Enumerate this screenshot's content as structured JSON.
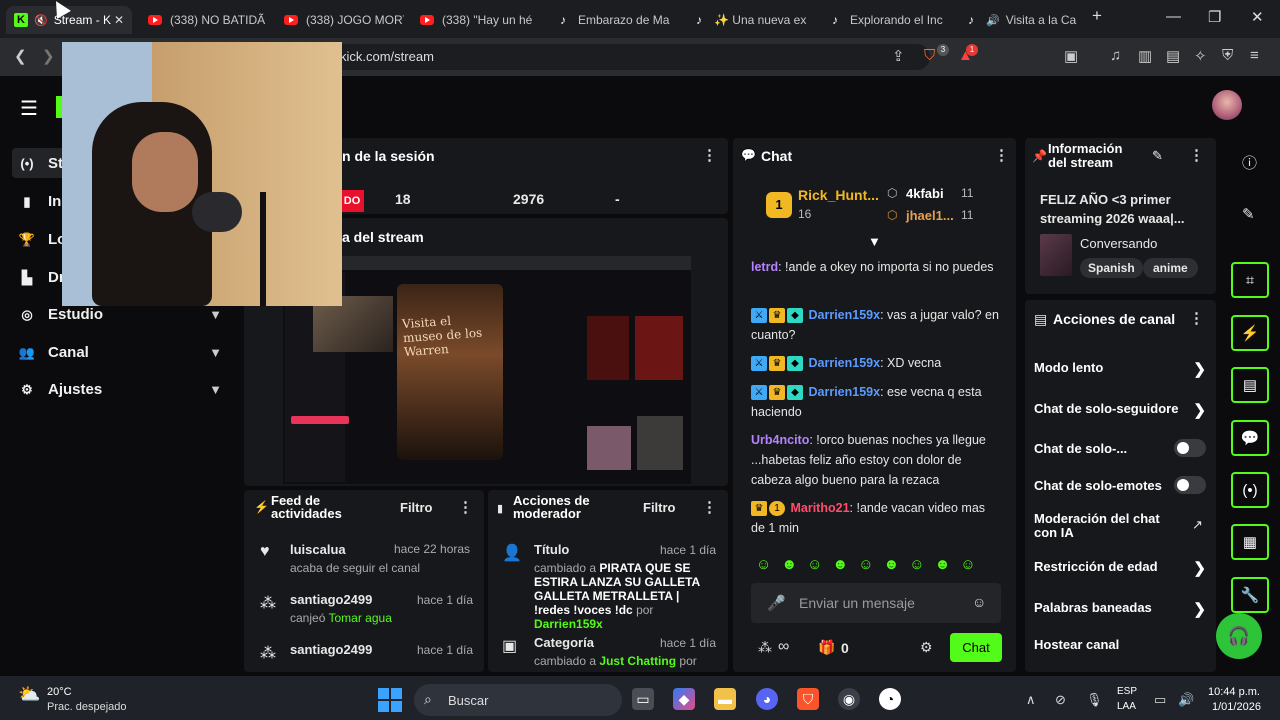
{
  "browser": {
    "tabs": [
      {
        "label": "Stream - K",
        "favicon": "kick"
      },
      {
        "label": "(338) NO BATIDÃ",
        "favicon": "youtube"
      },
      {
        "label": "(338) JOGO MORT",
        "favicon": "youtube"
      },
      {
        "label": "(338) \"Hay un hé",
        "favicon": "youtube"
      },
      {
        "label": "Embarazo de Ma",
        "favicon": "tiktok"
      },
      {
        "label": "✨ Una nueva ex",
        "favicon": "tiktok"
      },
      {
        "label": "Explorando el Inc",
        "favicon": "tiktok"
      },
      {
        "label": "Visita a la Ca",
        "favicon": "tiktok"
      }
    ],
    "new_tab": "+",
    "url": "kick.com/stream",
    "brave_badge": "3",
    "alert_badge": "1"
  },
  "sidebar": {
    "items": [
      {
        "label": "St",
        "icon": "broadcast-icon"
      },
      {
        "label": "In",
        "icon": "chart-icon"
      },
      {
        "label": "Lo",
        "icon": "trophy-icon"
      },
      {
        "label": "Dr",
        "icon": "drops-icon"
      },
      {
        "label": "Estudio",
        "icon": "target-icon"
      },
      {
        "label": "Canal",
        "icon": "users-icon"
      },
      {
        "label": "Ajustes",
        "icon": "gear-icon"
      }
    ]
  },
  "session": {
    "title": "n de la sesión",
    "live_label": "DO",
    "stat1": "18",
    "stat2": "2976",
    "stat3": "-"
  },
  "preview": {
    "title": "a del stream"
  },
  "chat": {
    "title": "Chat",
    "leaders": {
      "top_name": "Rick_Hunt...",
      "top_count": "16",
      "rank_badge": "1",
      "second_name": "4kfabi",
      "second_count": "11",
      "third_name": "jhael1...",
      "third_count": "11"
    },
    "messages": [
      {
        "user": "letrd",
        "text": "!ande a okey no importa si no puedes",
        "color": "#b583ff"
      },
      {
        "user": "Darrien159x",
        "text": "vas a jugar valo? en cuanto?",
        "color": "#5b9bff"
      },
      {
        "user": "Darrien159x",
        "text": "XD vecna",
        "color": "#5b9bff"
      },
      {
        "user": "Darrien159x",
        "text": "ese vecna q esta haciendo",
        "color": "#5b9bff"
      },
      {
        "user": "Urb4ncito",
        "text": "!orco buenas noches ya llegue ...habetas feliz año estoy con dolor de cabeza algo bueno para la rezaca",
        "color": "#b583ff"
      },
      {
        "user": "Maritho21",
        "text": "!ande vacan video mas de 1 min",
        "color": "#ff4d6d"
      }
    ],
    "input_placeholder": "Enviar un mensaje",
    "viewers_icon": "∞",
    "gift_count": "0",
    "send_label": "Chat"
  },
  "info": {
    "title": "Información del stream",
    "stream_title": "FELIZ AÑO <3 primer streaming 2026 waaa|...",
    "category": "Conversando",
    "tags": [
      "Spanish",
      "anime"
    ]
  },
  "actions": {
    "title": "Acciones de canal",
    "items": [
      {
        "label": "Modo lento",
        "control": "chevron"
      },
      {
        "label": "Chat de solo-seguidore",
        "control": "chevron"
      },
      {
        "label": "Chat de solo-...",
        "control": "toggle"
      },
      {
        "label": "Chat de solo-emotes",
        "control": "toggle"
      },
      {
        "label": "Moderación del chat con IA",
        "control": "external"
      },
      {
        "label": "Restricción de edad",
        "control": "chevron"
      },
      {
        "label": "Palabras baneadas",
        "control": "chevron"
      },
      {
        "label": "Hostear canal",
        "control": "none"
      }
    ]
  },
  "feed": {
    "title": "Feed de actividades",
    "filter": "Filtro",
    "items": [
      {
        "user": "luiscalua",
        "time": "hace 22 horas",
        "desc": "acaba de seguir el canal",
        "extra": ""
      },
      {
        "user": "santiago2499",
        "time": "hace 1 día",
        "desc": "canjeó",
        "extra": "Tomar agua"
      },
      {
        "user": "santiago2499",
        "time": "hace 1 día",
        "desc": "",
        "extra": ""
      }
    ]
  },
  "modactions": {
    "title": "Acciones de moderador",
    "filter": "Filtro",
    "items": [
      {
        "label": "Título",
        "time": "hace 1 día",
        "pre": "cambiado a",
        "value": "PIRATA QUE SE ESTIRA LANZA SU GALLETA GALLETA METRALLETA | !redes !voces !dc",
        "by": "por",
        "user": "Darrien159x"
      },
      {
        "label": "Categoría",
        "time": "hace 1 día",
        "pre": "cambiado a",
        "value": "Just Chatting",
        "by": "por",
        "user": ""
      }
    ]
  },
  "taskbar": {
    "temp": "20°C",
    "weather": "Prac. despejado",
    "search": "Buscar",
    "lang1": "ESP",
    "lang2": "LAA",
    "time": "10:44 p.m.",
    "date": "1/01/2026"
  },
  "colors": {
    "accent": "#53fc18",
    "bg": "#0b0b0d",
    "panel": "#17181b"
  }
}
